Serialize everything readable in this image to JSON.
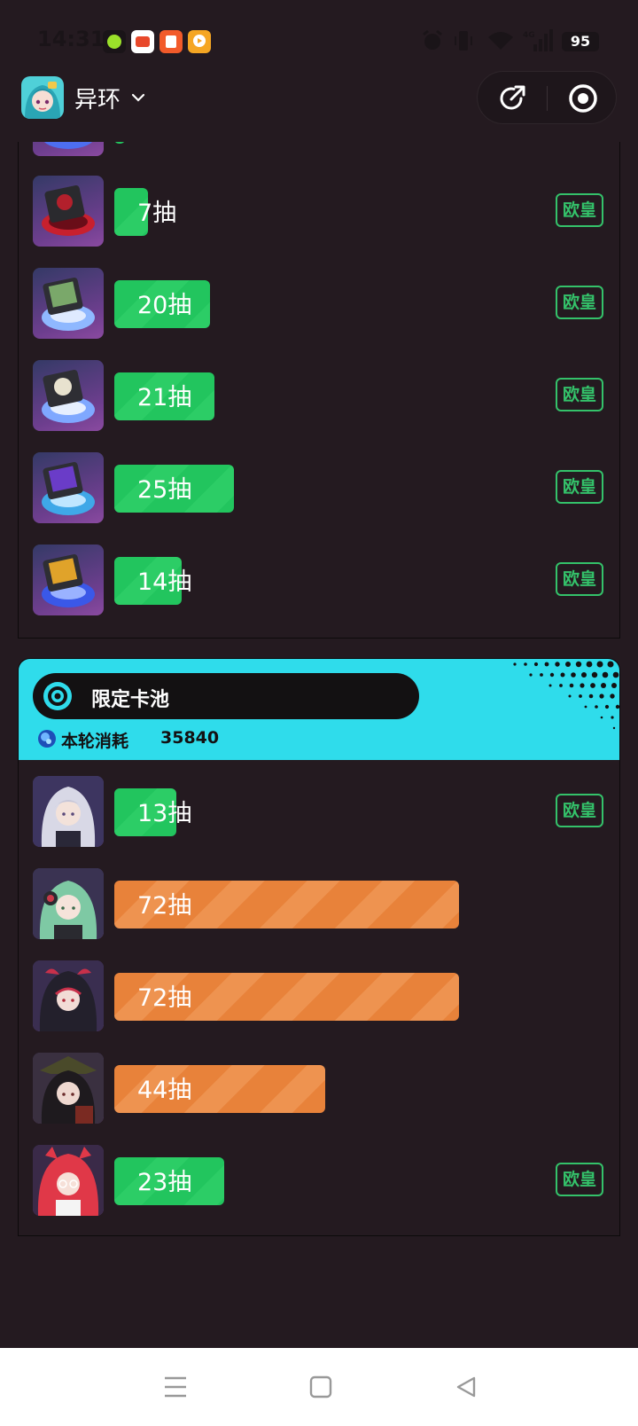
{
  "status_bar": {
    "time": "14:31",
    "battery": "95",
    "network": "4G"
  },
  "header": {
    "game_name": "异环"
  },
  "top_card": {
    "rows": [
      {
        "pulls": "7抽",
        "fill": 0.07,
        "color": "green",
        "badge": "欧皇",
        "thumb": "disc-red"
      },
      {
        "pulls": "20抽",
        "fill": 0.2,
        "color": "green",
        "badge": "欧皇",
        "thumb": "disc-green"
      },
      {
        "pulls": "21抽",
        "fill": 0.21,
        "color": "green",
        "badge": "欧皇",
        "thumb": "disc-white"
      },
      {
        "pulls": "25抽",
        "fill": 0.25,
        "color": "green",
        "badge": "欧皇",
        "thumb": "disc-purple"
      },
      {
        "pulls": "14抽",
        "fill": 0.14,
        "color": "green",
        "badge": "欧皇",
        "thumb": "disc-gold"
      }
    ]
  },
  "limited_pool": {
    "title": "限定卡池",
    "cost_label": "本轮消耗",
    "cost_value": "35840",
    "rows": [
      {
        "pulls": "13抽",
        "fill": 0.13,
        "color": "green",
        "badge": "欧皇",
        "thumb": "char-white-hair"
      },
      {
        "pulls": "72抽",
        "fill": 0.72,
        "color": "orange",
        "badge": "",
        "thumb": "char-green-hair"
      },
      {
        "pulls": "72抽",
        "fill": 0.72,
        "color": "orange",
        "badge": "",
        "thumb": "char-dark-hair"
      },
      {
        "pulls": "44抽",
        "fill": 0.44,
        "color": "orange",
        "badge": "",
        "thumb": "char-black-hair"
      },
      {
        "pulls": "23抽",
        "fill": 0.23,
        "color": "green",
        "badge": "欧皇",
        "thumb": "char-red-hair"
      }
    ]
  },
  "colors": {
    "background": "#241a20",
    "green": "#22c55e",
    "orange": "#e8823a",
    "limited_header": "#2fdceb",
    "badge": "#34c26a"
  }
}
